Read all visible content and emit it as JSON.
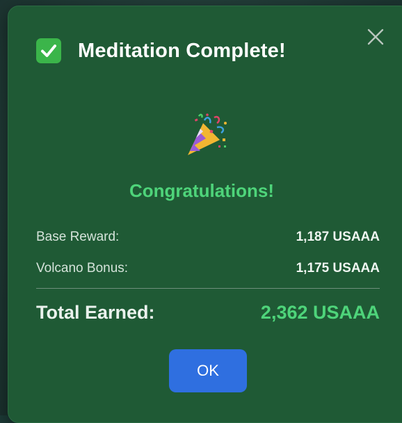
{
  "dialog": {
    "title": "Meditation Complete!",
    "title_icon": "check-mark-button-icon",
    "close_icon": "close-icon",
    "celebration_icon": "party-popper-icon",
    "congrats_text": "Congratulations!",
    "rewards": {
      "base_label": "Base Reward:",
      "base_value": "1,187 USAAA",
      "bonus_label": "Volcano Bonus:",
      "bonus_value": "1,175 USAAA",
      "total_label": "Total Earned:",
      "total_value": "2,362 USAAA"
    },
    "ok_label": "OK"
  },
  "colors": {
    "dialog_background": "#1f5a35",
    "accent_green": "#4ed47a",
    "button_blue": "#2f6fe0",
    "check_green": "#3bb54a"
  }
}
